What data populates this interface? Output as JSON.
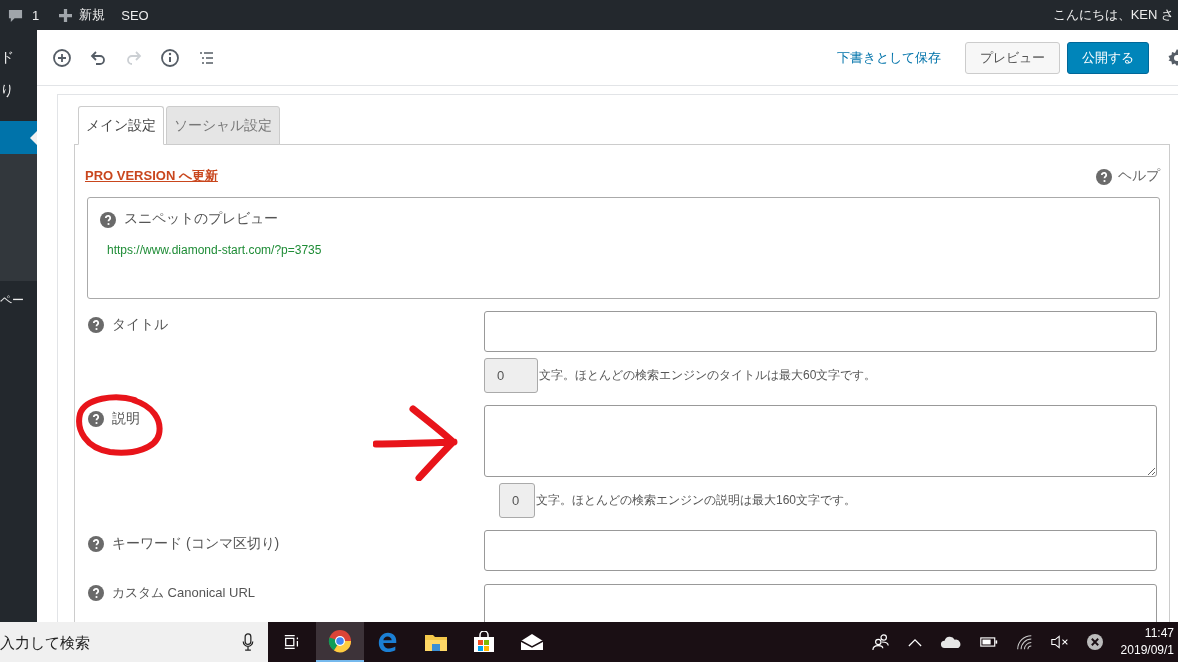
{
  "admin_bar": {
    "comments": "1",
    "new": "新規",
    "seo": "SEO",
    "greeting": "こんにちは、KEN さ"
  },
  "sidebar": {
    "items": [
      {
        "label": "ド",
        "selected": false
      },
      {
        "label": "り",
        "selected": false
      },
      {
        "selected": true
      },
      {
        "label": "ペー",
        "selected": false
      }
    ]
  },
  "toolbar": {
    "save_draft": "下書きとして保存",
    "preview": "プレビュー",
    "publish": "公開する"
  },
  "tabs": [
    {
      "label": "メイン設定",
      "selected": true
    },
    {
      "label": "ソーシャル設定",
      "selected": false
    }
  ],
  "pro_link": "PRO VERSION へ更新",
  "help": "ヘルプ",
  "snippet": {
    "title": "スニペットのプレビュー",
    "url": "https://www.diamond-start.com/?p=3735"
  },
  "fields": [
    {
      "kind": "input",
      "label": "タイトル",
      "counter": "0",
      "note": "文字。ほとんどの検索エンジンのタイトルは最大60文字です。"
    },
    {
      "kind": "textarea",
      "label": "説明",
      "counter": "0",
      "note": "文字。ほとんどの検索エンジンの説明は最大160文字です。"
    },
    {
      "kind": "input",
      "label": "キーワード (コンマ区切り)"
    },
    {
      "kind": "input",
      "label": "カスタム Canonical URL"
    }
  ],
  "annotations": [
    {
      "kind": "circle"
    },
    {
      "kind": "arrow"
    }
  ],
  "taskbar": {
    "placeholder": "入力して検索",
    "apps": [
      {
        "kind": "task-view",
        "selected": false
      },
      {
        "kind": "chrome",
        "selected": true
      },
      {
        "kind": "edge",
        "selected": false
      },
      {
        "kind": "folder",
        "selected": false
      },
      {
        "kind": "store",
        "selected": false
      },
      {
        "kind": "mail",
        "selected": false
      }
    ],
    "time": "11:47",
    "date": "2019/09/1"
  }
}
